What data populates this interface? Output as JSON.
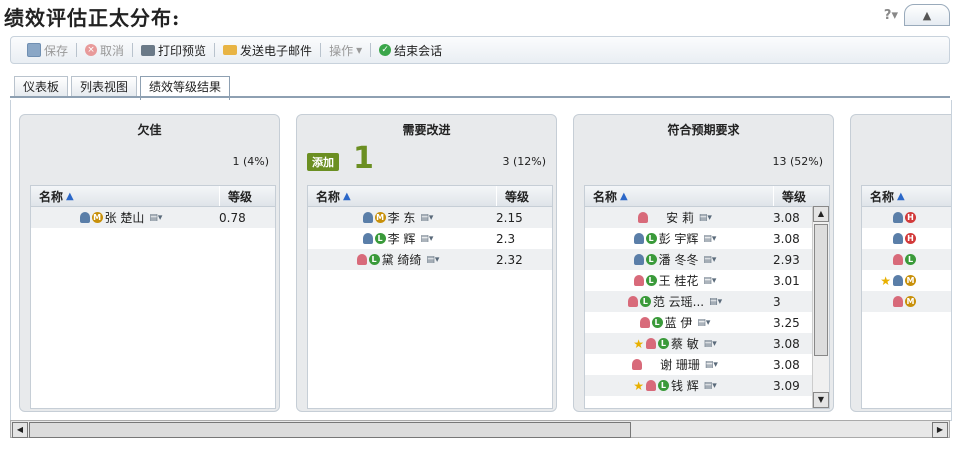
{
  "page": {
    "title": "绩效评估正太分布:"
  },
  "toolbar": {
    "save": "保存",
    "cancel": "取消",
    "print_preview": "打印预览",
    "send_email": "发送电子邮件",
    "actions": "操作",
    "end_session": "结束会话"
  },
  "tabs": [
    {
      "label": "仪表板"
    },
    {
      "label": "列表视图"
    },
    {
      "label": "绩效等级结果"
    }
  ],
  "grid_headers": {
    "name": "名称",
    "grade": "等级"
  },
  "columns": [
    {
      "title": "欠佳",
      "count": "1 (4%)",
      "rows": [
        {
          "name": "张 楚山",
          "grade": "0.78",
          "gender": "m",
          "level": "M",
          "star": false
        }
      ]
    },
    {
      "title": "需要改进",
      "count": "3 (12%)",
      "add_label": "添加",
      "big_number": "1",
      "rows": [
        {
          "name": "李 东",
          "grade": "2.15",
          "gender": "m",
          "level": "M",
          "star": false
        },
        {
          "name": "李 辉",
          "grade": "2.3",
          "gender": "m",
          "level": "L",
          "star": false
        },
        {
          "name": "黛 绮绮",
          "grade": "2.32",
          "gender": "f",
          "level": "L",
          "star": false
        }
      ]
    },
    {
      "title": "符合预期要求",
      "count": "13 (52%)",
      "rows": [
        {
          "name": "安 莉",
          "grade": "3.08",
          "gender": "f",
          "level": "",
          "star": false
        },
        {
          "name": "彭 宇辉",
          "grade": "3.08",
          "gender": "m",
          "level": "L",
          "star": false
        },
        {
          "name": "潘 冬冬",
          "grade": "2.93",
          "gender": "m",
          "level": "L",
          "star": false
        },
        {
          "name": "王 桂花",
          "grade": "3.01",
          "gender": "f",
          "level": "L",
          "star": false
        },
        {
          "name": "范 云瑶...",
          "grade": "3",
          "gender": "f",
          "level": "L",
          "star": false
        },
        {
          "name": "蓝 伊",
          "grade": "3.25",
          "gender": "f",
          "level": "L",
          "star": false
        },
        {
          "name": "蔡 敏",
          "grade": "3.08",
          "gender": "f",
          "level": "L",
          "star": true
        },
        {
          "name": "谢 珊珊",
          "grade": "3.08",
          "gender": "f",
          "level": "",
          "star": false
        },
        {
          "name": "钱 辉",
          "grade": "3.09",
          "gender": "f",
          "level": "L",
          "star": true
        }
      ]
    },
    {
      "title": "",
      "count": "",
      "rows": [
        {
          "name": "",
          "grade": "",
          "gender": "m",
          "level": "H",
          "star": false
        },
        {
          "name": "",
          "grade": "",
          "gender": "m",
          "level": "H",
          "star": false
        },
        {
          "name": "",
          "grade": "",
          "gender": "f",
          "level": "L",
          "star": false
        },
        {
          "name": "",
          "grade": "",
          "gender": "m",
          "level": "M",
          "star": true
        },
        {
          "name": "",
          "grade": "",
          "gender": "f",
          "level": "M",
          "star": false
        }
      ]
    }
  ]
}
